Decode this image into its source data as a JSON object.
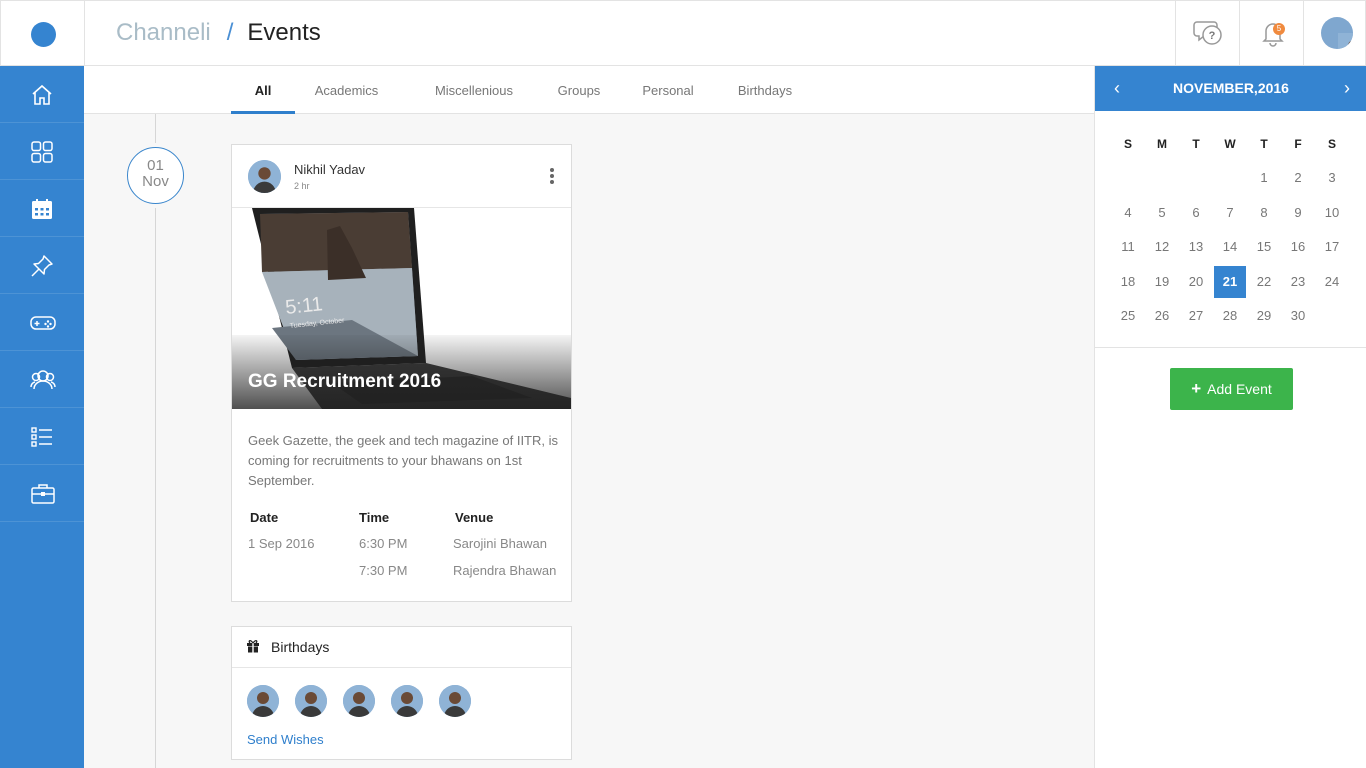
{
  "colors": {
    "primary": "#3584d0",
    "accent_green": "#3cb44b",
    "badge": "#f08a3e"
  },
  "header": {
    "breadcrumb_root": "Channeli",
    "breadcrumb_sep": "/",
    "breadcrumb_current": "Events",
    "notification_count": "5"
  },
  "sidebar": {
    "items": [
      {
        "icon": "home-icon"
      },
      {
        "icon": "apps-grid-icon"
      },
      {
        "icon": "calendar-icon"
      },
      {
        "icon": "pin-icon"
      },
      {
        "icon": "gamepad-icon"
      },
      {
        "icon": "groups-icon"
      },
      {
        "icon": "list-icon"
      },
      {
        "icon": "briefcase-icon"
      }
    ]
  },
  "tabs": [
    "All",
    "Academics",
    "Miscellenious",
    "Groups",
    "Personal",
    "Birthdays"
  ],
  "timeline": {
    "day": "01",
    "month": "Nov"
  },
  "event": {
    "author": "Nikhil Yadav",
    "time_ago": "2 hr",
    "title": "GG Recruitment 2016",
    "description": "Geek Gazette, the geek and tech magazine of IITR, is coming for recruitments to your bhawans on 1st September.",
    "columns": {
      "date": "Date",
      "time": "Time",
      "venue": "Venue"
    },
    "date": "1 Sep 2016",
    "times": [
      "6:30 PM",
      "7:30 PM"
    ],
    "venues": [
      "Sarojini Bhawan",
      "Rajendra Bhawan"
    ],
    "image_clock": "5:11",
    "image_date": "Tuesday, October"
  },
  "birthdays": {
    "title": "Birthdays",
    "action": "Send Wishes",
    "count": 5
  },
  "calendar": {
    "title": "NOVEMBER,2016",
    "prev": "‹",
    "next": "›",
    "weekdays": [
      "S",
      "M",
      "T",
      "W",
      "T",
      "F",
      "S"
    ],
    "weeks": [
      [
        "",
        "",
        "",
        "",
        "1",
        "2",
        "3"
      ],
      [
        "4",
        "5",
        "6",
        "7",
        "8",
        "9",
        "10"
      ],
      [
        "11",
        "12",
        "13",
        "14",
        "15",
        "16",
        "17"
      ],
      [
        "18",
        "19",
        "20",
        "21",
        "22",
        "23",
        "24"
      ],
      [
        "25",
        "26",
        "27",
        "28",
        "29",
        "30",
        ""
      ]
    ],
    "selected": "21",
    "add_button": "Add Event",
    "add_plus": "+"
  }
}
